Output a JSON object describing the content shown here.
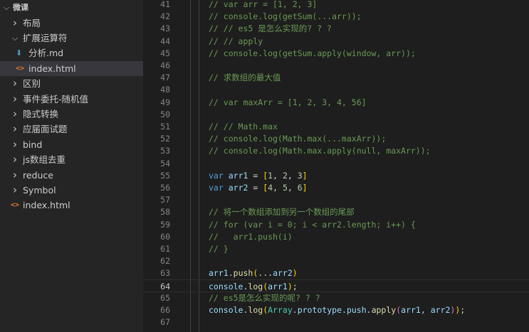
{
  "sidebar": {
    "root": "微课",
    "items": [
      {
        "kind": "folder",
        "open": false,
        "depth": 1,
        "label": "布局"
      },
      {
        "kind": "folder",
        "open": true,
        "depth": 1,
        "label": "扩展运算符"
      },
      {
        "kind": "md",
        "depth": 2,
        "label": "分析.md"
      },
      {
        "kind": "html",
        "depth": 2,
        "label": "index.html",
        "selected": true
      },
      {
        "kind": "folder",
        "open": false,
        "depth": 1,
        "label": "区别"
      },
      {
        "kind": "folder",
        "open": false,
        "depth": 1,
        "label": "事件委托-随机值"
      },
      {
        "kind": "folder",
        "open": false,
        "depth": 1,
        "label": "隐式转换"
      },
      {
        "kind": "folder",
        "open": false,
        "depth": 1,
        "label": "应届面试题"
      },
      {
        "kind": "folder",
        "open": false,
        "depth": 1,
        "label": "bind"
      },
      {
        "kind": "folder",
        "open": false,
        "depth": 1,
        "label": "js数组去重"
      },
      {
        "kind": "folder",
        "open": false,
        "depth": 1,
        "label": "reduce"
      },
      {
        "kind": "folder",
        "open": false,
        "depth": 1,
        "label": "Symbol"
      },
      {
        "kind": "html",
        "depth": 0,
        "label": "index.html"
      }
    ]
  },
  "editor": {
    "current_line": 64,
    "lines": [
      {
        "n": "41",
        "t": [
          [
            "c",
            "// var arr = [1, 2, 3]"
          ]
        ]
      },
      {
        "n": "42",
        "t": [
          [
            "c",
            "// console.log(getSum(...arr));"
          ]
        ]
      },
      {
        "n": "43",
        "t": [
          [
            "c",
            "// // es5 是怎么实现的? ? ?"
          ]
        ]
      },
      {
        "n": "44",
        "t": [
          [
            "c",
            "// // apply"
          ]
        ]
      },
      {
        "n": "45",
        "t": [
          [
            "c",
            "// console.log(getSum.apply(window, arr));"
          ]
        ]
      },
      {
        "n": "46",
        "t": []
      },
      {
        "n": "47",
        "t": [
          [
            "c",
            "// 求数组的最大值"
          ]
        ]
      },
      {
        "n": "48",
        "t": []
      },
      {
        "n": "49",
        "t": [
          [
            "c",
            "// var maxArr = [1, 2, 3, 4, 56]"
          ]
        ]
      },
      {
        "n": "50",
        "t": []
      },
      {
        "n": "51",
        "t": [
          [
            "c",
            "// // Math.max"
          ]
        ]
      },
      {
        "n": "52",
        "t": [
          [
            "c",
            "// console.log(Math.max(...maxArr));"
          ]
        ]
      },
      {
        "n": "53",
        "t": [
          [
            "c",
            "// console.log(Math.max.apply(null, maxArr));"
          ]
        ]
      },
      {
        "n": "54",
        "t": []
      },
      {
        "n": "55",
        "t": [
          [
            "k",
            "var"
          ],
          [
            "p",
            " "
          ],
          [
            "v",
            "arr1"
          ],
          [
            "p",
            " = "
          ],
          [
            "b1",
            "["
          ],
          [
            "n",
            "1"
          ],
          [
            "p",
            ", "
          ],
          [
            "n",
            "2"
          ],
          [
            "p",
            ", "
          ],
          [
            "n",
            "3"
          ],
          [
            "b1",
            "]"
          ]
        ]
      },
      {
        "n": "56",
        "t": [
          [
            "k",
            "var"
          ],
          [
            "p",
            " "
          ],
          [
            "v",
            "arr2"
          ],
          [
            "p",
            " = "
          ],
          [
            "b1",
            "["
          ],
          [
            "n",
            "4"
          ],
          [
            "p",
            ", "
          ],
          [
            "n",
            "5"
          ],
          [
            "p",
            ", "
          ],
          [
            "n",
            "6"
          ],
          [
            "b1",
            "]"
          ]
        ]
      },
      {
        "n": "57",
        "t": []
      },
      {
        "n": "58",
        "t": [
          [
            "c",
            "// 将一个数组添加到另一个数组的尾部"
          ]
        ]
      },
      {
        "n": "59",
        "t": [
          [
            "c",
            "// for (var i = 0; i < arr2.length; i++) {"
          ]
        ]
      },
      {
        "n": "60",
        "t": [
          [
            "c",
            "//   arr1.push(i)"
          ]
        ]
      },
      {
        "n": "61",
        "t": [
          [
            "c",
            "// }"
          ]
        ]
      },
      {
        "n": "62",
        "t": []
      },
      {
        "n": "63",
        "t": [
          [
            "v",
            "arr1"
          ],
          [
            "p",
            "."
          ],
          [
            "f",
            "push"
          ],
          [
            "b1",
            "("
          ],
          [
            "p",
            "..."
          ],
          [
            "v",
            "arr2"
          ],
          [
            "b1",
            ")"
          ]
        ]
      },
      {
        "n": "64",
        "t": [
          [
            "v",
            "console"
          ],
          [
            "p",
            "."
          ],
          [
            "f",
            "log"
          ],
          [
            "b1",
            "("
          ],
          [
            "v",
            "arr1"
          ],
          [
            "b1",
            ")"
          ],
          [
            "p",
            ";"
          ]
        ]
      },
      {
        "n": "65",
        "t": [
          [
            "c",
            "// es5是怎么实现的呢? ? ?"
          ]
        ]
      },
      {
        "n": "66",
        "t": [
          [
            "v",
            "console"
          ],
          [
            "p",
            "."
          ],
          [
            "f",
            "log"
          ],
          [
            "b1",
            "("
          ],
          [
            "cl",
            "Array"
          ],
          [
            "p",
            "."
          ],
          [
            "v",
            "prototype"
          ],
          [
            "p",
            "."
          ],
          [
            "v",
            "push"
          ],
          [
            "p",
            "."
          ],
          [
            "f",
            "apply"
          ],
          [
            "b2",
            "("
          ],
          [
            "v",
            "arr1"
          ],
          [
            "p",
            ", "
          ],
          [
            "v",
            "arr2"
          ],
          [
            "b2",
            ")"
          ],
          [
            "b1",
            ")"
          ],
          [
            "p",
            ";"
          ]
        ]
      },
      {
        "n": "67",
        "t": []
      }
    ]
  }
}
